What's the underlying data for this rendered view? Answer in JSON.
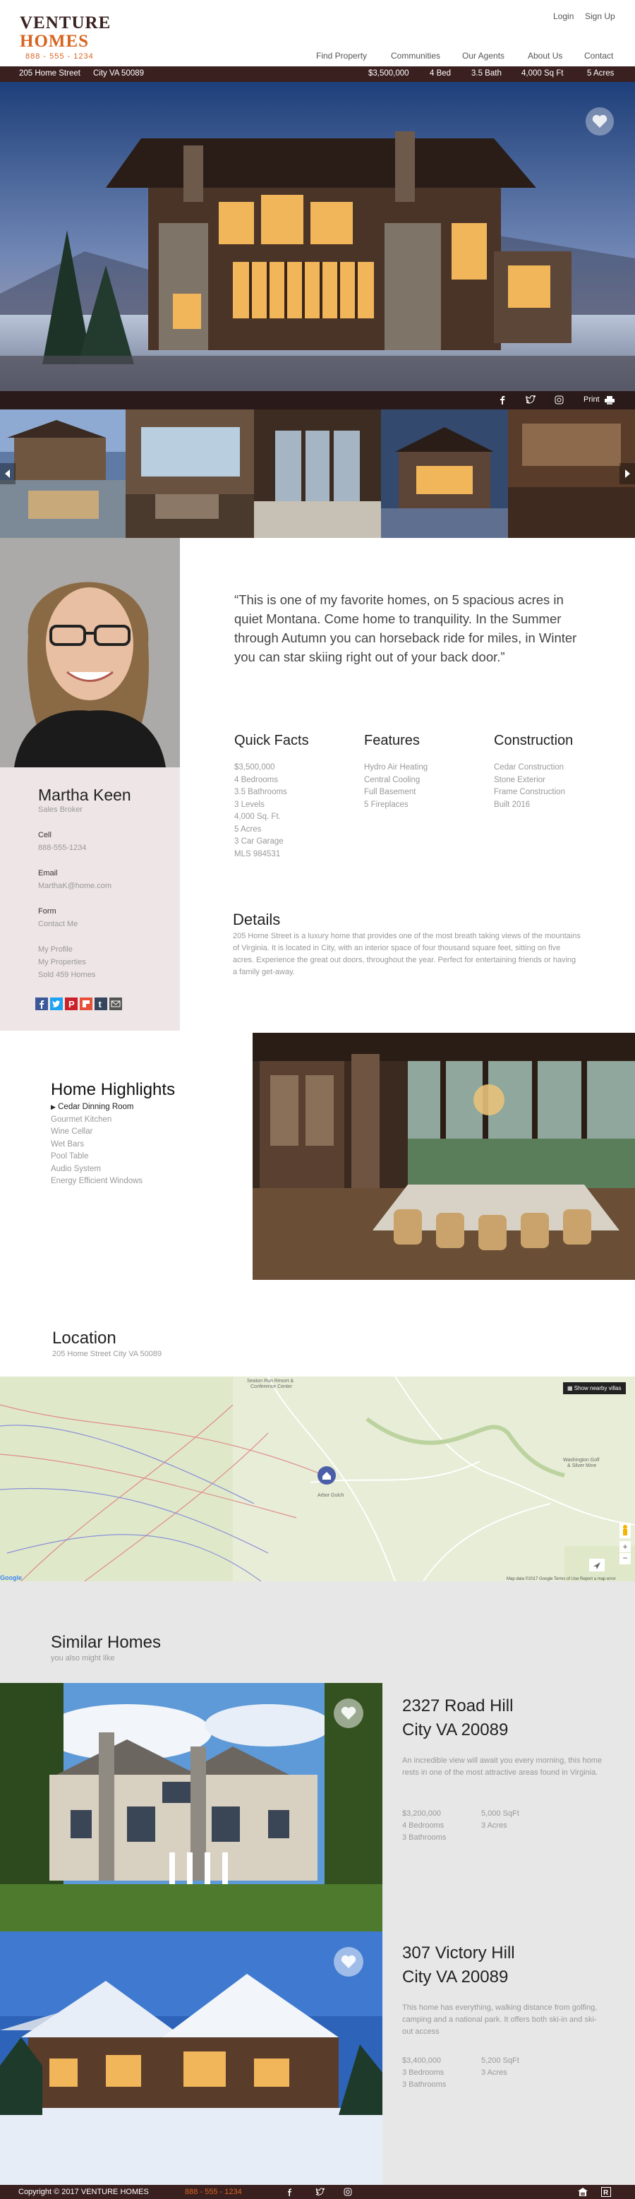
{
  "brand": {
    "line1": "VENTURE",
    "line2": "HOMES",
    "phone": "888 - 555 - 1234"
  },
  "top_links": {
    "login": "Login",
    "signup": "Sign Up"
  },
  "nav": [
    "Find Property",
    "Communities",
    "Our Agents",
    "About Us",
    "Contact"
  ],
  "infobar": {
    "address": "205 Home Street",
    "city": "City VA  50089",
    "price": "$3,500,000",
    "beds": "4 Bed",
    "baths": "3.5 Bath",
    "sqft": "4,000 Sq Ft",
    "acres": "5 Acres"
  },
  "share": {
    "print": "Print",
    "icons": [
      "facebook-icon",
      "twitter-icon",
      "instagram-icon",
      "print-icon"
    ]
  },
  "agent": {
    "name": "Martha Keen",
    "title": "Sales Broker",
    "cell_label": "Cell",
    "cell": "888-555-1234",
    "email_label": "Email",
    "email": "MarthaK@home.com",
    "form_label": "Form",
    "form": "Contact Me",
    "links": [
      "My Profile",
      "My Properties",
      "Sold 459 Homes"
    ],
    "social_colors": [
      "#3b5998",
      "#1da1f2",
      "#cb2027",
      "#e8503a",
      "#35465c",
      "#555555"
    ]
  },
  "quote": "“This is one of my favorite homes, on 5 spacious acres in quiet Montana. Come home to tranquility. In the Summer through Autumn  you can horseback ride for miles, in Winter you can star skiing right out of your back door.”",
  "quick_facts": {
    "title": "Quick Facts",
    "items": [
      "$3,500,000",
      "4 Bedrooms",
      "3.5 Bathrooms",
      "3 Levels",
      "4,000 Sq. Ft.",
      "5 Acres",
      "3 Car Garage",
      "MLS 984531"
    ]
  },
  "features": {
    "title": "Features",
    "items": [
      "Hydro Air Heating",
      "Central Cooling",
      "Full Basement",
      "5 Fireplaces"
    ]
  },
  "construction": {
    "title": "Construction",
    "items": [
      "Cedar Construction",
      "Stone Exterior",
      "Frame Construction",
      "Built 2016"
    ]
  },
  "details": {
    "title": "Details",
    "text": "205 Home Street is a luxury home that provides one of the most breath taking views of the mountains of Virginia.  It is located in City, with an interior space of four thousand square feet, sitting on five acres. Experience the great out doors, throughout the year. Perfect for entertaining friends or having a family get-away."
  },
  "highlights": {
    "title": "Home Highlights",
    "active": "Cedar Dinning Room",
    "items": [
      "Gourmet Kitchen",
      "Wine Cellar",
      "Wet Bars",
      "Pool Table",
      "Audio System",
      "Energy Efficient Windows"
    ]
  },
  "location": {
    "title": "Location",
    "address": "205 Home Street City VA 50089",
    "map_button": "Show nearby villas",
    "map_labels": [
      "Seaton Run Resort & Conference Center",
      "Washington Golf & Silver Mine",
      "Arbor Gulch"
    ],
    "map_footer": "Map data ©2017 Google   Terms of Use   Report a map error"
  },
  "similar": {
    "title": "Similar Homes",
    "subtitle": "you also might like",
    "homes": [
      {
        "line1": "2327 Road Hill",
        "line2": "City VA 20089",
        "desc": "An incredible view will await you every morning, this home rests in one of the most attractive areas found in Virginia.",
        "price": "$3,200,000",
        "beds": "4 Bedrooms",
        "baths": "3 Bathrooms",
        "sqft": "5,000 SqFt",
        "acres": "3 Acres"
      },
      {
        "line1": "307 Victory Hill",
        "line2": "City VA 20089",
        "desc": "This home has everything, walking distance from golfing, camping and a national park. It offers both ski-in and ski-out access",
        "price": "$3,400,000",
        "beds": "3 Bedrooms",
        "baths": "3 Bathrooms",
        "sqft": "5,200 SqFt",
        "acres": "3 Acres"
      }
    ]
  },
  "footer": {
    "copyright": "Copyright ©  2017  VENTURE HOMES",
    "phone": "888 - 555 - 1234",
    "icons": [
      "facebook-icon",
      "twitter-icon",
      "instagram-icon",
      "equal-housing-icon",
      "realtor-icon"
    ]
  }
}
